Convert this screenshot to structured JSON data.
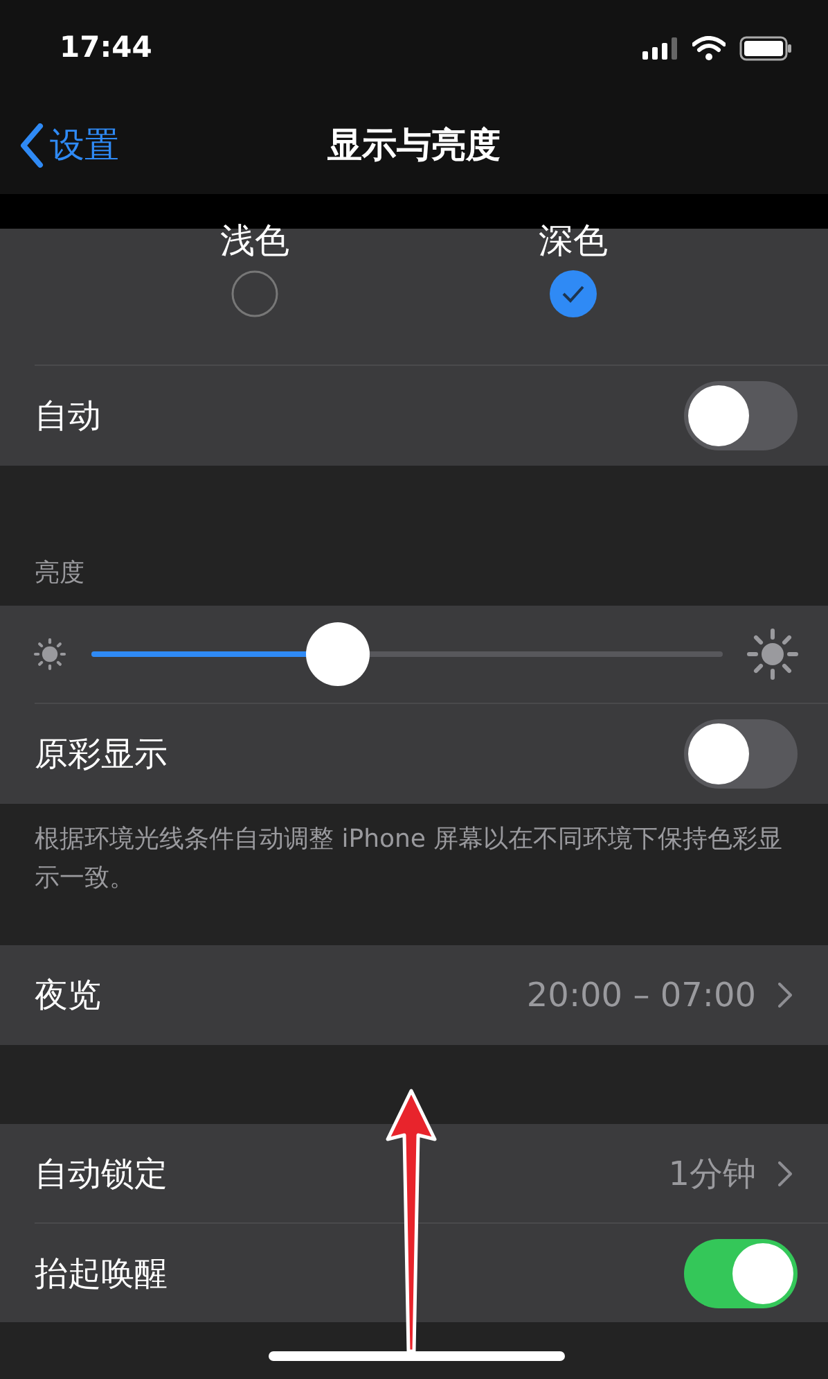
{
  "status_bar": {
    "time": "17:44"
  },
  "nav": {
    "back": "设置",
    "title": "显示与亮度"
  },
  "appearance": {
    "options": [
      {
        "label": "浅色",
        "selected": false
      },
      {
        "label": "深色",
        "selected": true
      }
    ],
    "auto": {
      "label": "自动",
      "on": false
    }
  },
  "brightness": {
    "header": "亮度",
    "level": 0.39,
    "true_tone": {
      "label": "原彩显示",
      "on": false
    },
    "footer": "根据环境光线条件自动调整 iPhone 屏幕以在不同环境下保持色彩显示一致。"
  },
  "night_shift": {
    "label": "夜览",
    "value": "20:00 – 07:00"
  },
  "lock_rows": [
    {
      "kind": "link",
      "label": "自动锁定",
      "value": "1分钟"
    },
    {
      "kind": "toggle",
      "label": "抬起唤醒",
      "on": true
    }
  ]
}
